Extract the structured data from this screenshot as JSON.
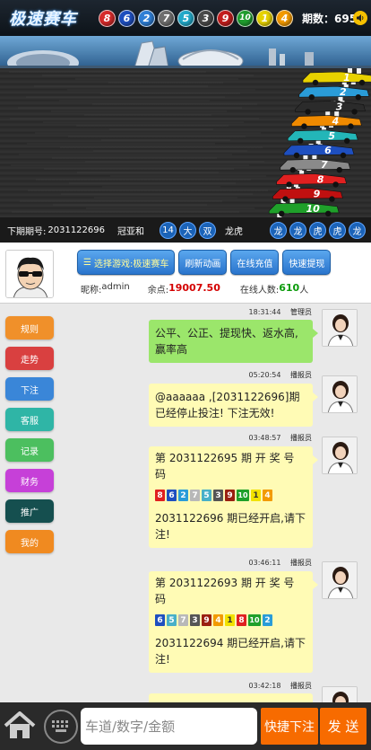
{
  "header": {
    "title": "极速赛车",
    "balls": [
      {
        "n": "8",
        "color": "#d62b2b"
      },
      {
        "n": "6",
        "color": "#1e4fbf"
      },
      {
        "n": "2",
        "color": "#2f7fd6"
      },
      {
        "n": "7",
        "color": "#6e6e6e"
      },
      {
        "n": "5",
        "color": "#22a9c9"
      },
      {
        "n": "3",
        "color": "#4a4a4a"
      },
      {
        "n": "9",
        "color": "#c41d1d"
      },
      {
        "n": "10",
        "color": "#1f9d2e"
      },
      {
        "n": "1",
        "color": "#e6d200"
      },
      {
        "n": "4",
        "color": "#f29a00"
      }
    ],
    "period_label": "期数：695",
    "speaker_icon": "speaker-icon"
  },
  "status": {
    "next_label": "下期期号:",
    "next_value": "2031122696",
    "guanyahe_label": "冠亚和",
    "guanyahe_values": [
      "14",
      "大",
      "双"
    ],
    "longhu_label": "龙虎",
    "longhu_values": [
      "龙",
      "龙",
      "虎",
      "虎",
      "龙"
    ]
  },
  "race": {
    "car_numbers": [
      "1",
      "2",
      "3",
      "4",
      "5",
      "6",
      "7",
      "8",
      "9",
      "10"
    ],
    "car_colors": [
      "#e8d200",
      "#2a9cd8",
      "#2b2b2b",
      "#f08a00",
      "#23b6b8",
      "#1e4fbf",
      "#8a8a8a",
      "#e02020",
      "#c01010",
      "#1fa02a"
    ]
  },
  "user": {
    "buttons": [
      "选择游戏:极速赛车",
      "刷新动画",
      "在线充值",
      "快速提现"
    ],
    "nickname_label": "昵称:",
    "nickname": "admin",
    "balance_label": "余点:",
    "balance": "19007.50",
    "online_label": "在线人数:",
    "online_count": "610",
    "online_unit": "人"
  },
  "sidebar": [
    {
      "label": "规则",
      "color": "#f0902a"
    },
    {
      "label": "走势",
      "color": "#d94040"
    },
    {
      "label": "下注",
      "color": "#3a86d8"
    },
    {
      "label": "客服",
      "color": "#2fb5a6"
    },
    {
      "label": "记录",
      "color": "#4cbf5f"
    },
    {
      "label": "财务",
      "color": "#c640d8"
    },
    {
      "label": "推广",
      "color": "#154f4f"
    },
    {
      "label": "我的",
      "color": "#f08a20"
    }
  ],
  "messages": [
    {
      "time": "18:31:44",
      "sender": "管理员",
      "text": "公平、公正、提现快、返水高,赢率高"
    },
    {
      "time": "05:20:54",
      "sender": "播报员",
      "text": "@aaaaaa ,[2031122696]期已经停止投注! 下注无效!"
    },
    {
      "time": "03:48:57",
      "sender": "播报员",
      "head": "第 2031122695 期 开 奖 号 码",
      "numbers": [
        {
          "n": "8",
          "color": "#e02020"
        },
        {
          "n": "6",
          "color": "#1e4fbf"
        },
        {
          "n": "2",
          "color": "#2a9cd8"
        },
        {
          "n": "7",
          "color": "#b8b8b8"
        },
        {
          "n": "5",
          "color": "#48b0c8"
        },
        {
          "n": "3",
          "color": "#555555"
        },
        {
          "n": "9",
          "color": "#9a2010"
        },
        {
          "n": "10",
          "color": "#1fa02a"
        },
        {
          "n": "1",
          "color": "#f2e200"
        },
        {
          "n": "4",
          "color": "#f29a00"
        }
      ],
      "tail": " 2031122696 期已经开启,请下注!"
    },
    {
      "time": "03:46:11",
      "sender": "播报员",
      "head": "第 2031122693 期 开 奖 号 码",
      "numbers": [
        {
          "n": "6",
          "color": "#1e4fbf"
        },
        {
          "n": "5",
          "color": "#48b0c8"
        },
        {
          "n": "7",
          "color": "#b8b8b8"
        },
        {
          "n": "3",
          "color": "#555555"
        },
        {
          "n": "9",
          "color": "#9a2010"
        },
        {
          "n": "4",
          "color": "#f29a00"
        },
        {
          "n": "1",
          "color": "#f2e200"
        },
        {
          "n": "8",
          "color": "#e02020"
        },
        {
          "n": "10",
          "color": "#1fa02a"
        },
        {
          "n": "2",
          "color": "#2a9cd8"
        }
      ],
      "tail": " 2031122694 期已经开启,请下注!"
    },
    {
      "time": "03:42:18",
      "sender": "播报员"
    }
  ],
  "bottom": {
    "placeholder": "车道/数字/金额",
    "quick_label": "快捷下注",
    "send_label": "发 送"
  }
}
